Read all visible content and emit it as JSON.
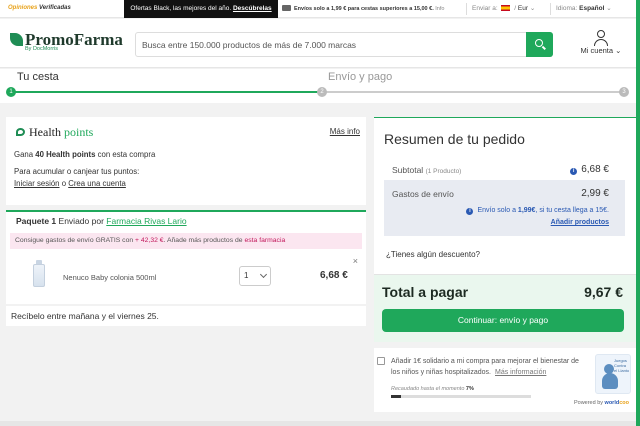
{
  "topbar": {
    "reviews_label": "Opiniones",
    "reviews_brand": "Verificadas",
    "promo_text": "Ofertas Black, las mejores del año.",
    "promo_link": "Descúbrelas",
    "shipping_text": "Envíos solo a 1,99 € para cestas superiores a 15,00 €.",
    "shipping_info": "Info",
    "ship_to_label": "Enviar a:",
    "currency": "Eur",
    "language_label": "Idioma:",
    "language_value": "Español"
  },
  "header": {
    "logo_text": "PromoFarma",
    "logo_sub": "By DocMorris",
    "search_placeholder": "Busca entre 150.000 productos de más de 7.000 marcas",
    "account_label": "Mi cuenta"
  },
  "steps": {
    "step_1": "Tu cesta",
    "step_2": "Envío y pago",
    "dot_1": "1",
    "dot_2": "2",
    "dot_3": "3"
  },
  "health": {
    "logo_word_1": "Health",
    "logo_word_2": "points",
    "more_info": "Más info",
    "line_1_pre": "Gana",
    "line_1_bold": "40 Health points",
    "line_1_post": "con esta compra",
    "line_2": "Para acumular o canjear tus puntos:",
    "login_link": "Iniciar sesión",
    "or": "o",
    "create_link": "Crea una cuenta"
  },
  "package": {
    "title_bold": "Paquete 1",
    "sent_by": "Enviado por",
    "pharmacy": "Farmacia Rivas Lario",
    "free_shipping_text": "Consigue gastos de envío GRATIS con",
    "free_shipping_amount": "+ 42,32 €",
    "free_shipping_mid": ". Añade más productos de",
    "free_shipping_link": "esta farmacia",
    "product_name": "Nenuco Baby colonia 500ml",
    "quantity": "1",
    "price": "6,68 €",
    "remove": "×"
  },
  "delivery_text": "Recíbelo entre mañana y el viernes 25.",
  "summary": {
    "title": "Resumen de tu pedido",
    "subtotal_label": "Subtotal",
    "subtotal_count": "(1 Producto)",
    "subtotal_value": "6,68 €",
    "shipping_label": "Gastos de envío",
    "shipping_value": "2,99 €",
    "shipping_note_pre": "Envío solo a",
    "shipping_note_amount": "1,99€",
    "shipping_note_post": ", si tu cesta llega a 15€.",
    "add_products": "Añadir productos",
    "discount": "¿Tienes algún descuento?",
    "total_label": "Total a pagar",
    "total_value": "9,67 €",
    "checkout_button": "Continuar: envío y pago"
  },
  "charity": {
    "text": "Añadir 1€ solidario a mi compra para mejorar el bienestar de los niños y niñas hospitalizados.",
    "more": "Más información",
    "raised_label": "Recaudado hasta el momento",
    "raised_value": "7%",
    "raised_fraction": 0.07,
    "logo_tag": "Juegos Contra el Llanto",
    "powered_label": "Powered by",
    "powered_brand": "world",
    "powered_brand_c": "coo"
  },
  "colors": {
    "brand_green": "#1fa85b",
    "pink_text": "#c2185b",
    "link_blue": "#2a59b3"
  }
}
